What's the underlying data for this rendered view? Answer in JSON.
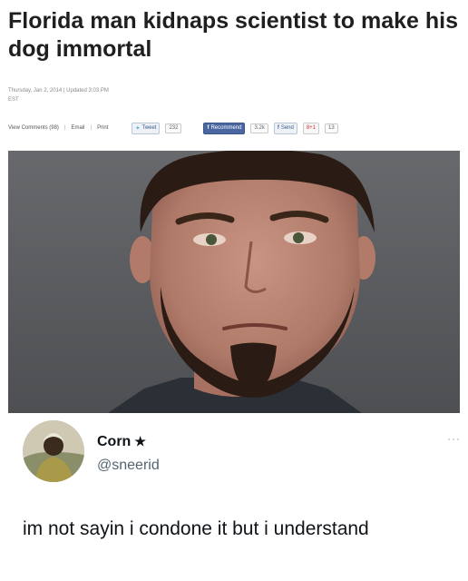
{
  "article": {
    "headline": "Florida man kidnaps scientist to make his dog immortal",
    "dateline": "Thursday, Jan 2, 2014 | Updated 3:03 PM",
    "timezone": "EST",
    "share_bar": {
      "view_comments": "View Comments (98)",
      "email": "Email",
      "print": "Print",
      "tweet_label": "Tweet",
      "tweet_count": "232",
      "recommend_label": "Recommend",
      "recommend_count": "3.2k",
      "send_label": "Send",
      "gplus_label": "8+1",
      "gplus_count": "13"
    }
  },
  "tweet": {
    "author_name": "Corn",
    "author_badge": "★",
    "handle": "@sneerid",
    "more_label": "···",
    "text": "im not sayin i condone it but i understand"
  },
  "colors": {
    "text": "#0f1419",
    "handle": "#536471",
    "photo_background": "#5a5c5f",
    "facebook": "#4b67a1"
  }
}
